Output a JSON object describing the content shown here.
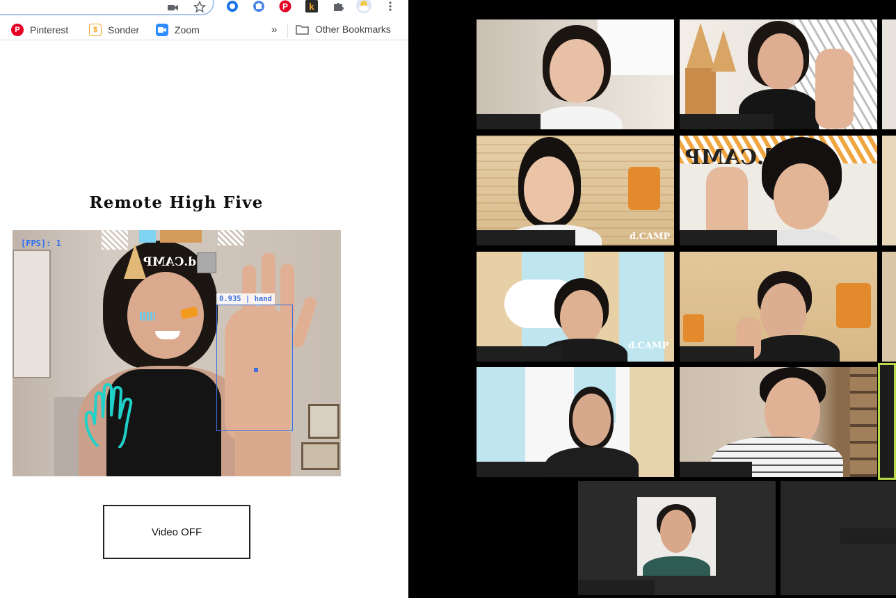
{
  "browser": {
    "bookmarks": [
      {
        "label": "Pinterest",
        "icon": "pinterest-icon",
        "color": "#e60023"
      },
      {
        "label": "Sonder",
        "icon": "sonder-icon",
        "color": "#f5a623"
      },
      {
        "label": "Zoom",
        "icon": "zoom-icon",
        "color": "#2d8cff"
      }
    ],
    "overflow_label": "»",
    "other_bookmarks_label": "Other Bookmarks"
  },
  "app": {
    "title": "Remote High Five",
    "fps_text": "[FPS]: 1",
    "detection_label": "0.935 | hand",
    "video_button_label": "Video OFF",
    "decoration_text": "d.CAMP"
  },
  "zoom": {
    "background_text": "d.CAMP"
  }
}
